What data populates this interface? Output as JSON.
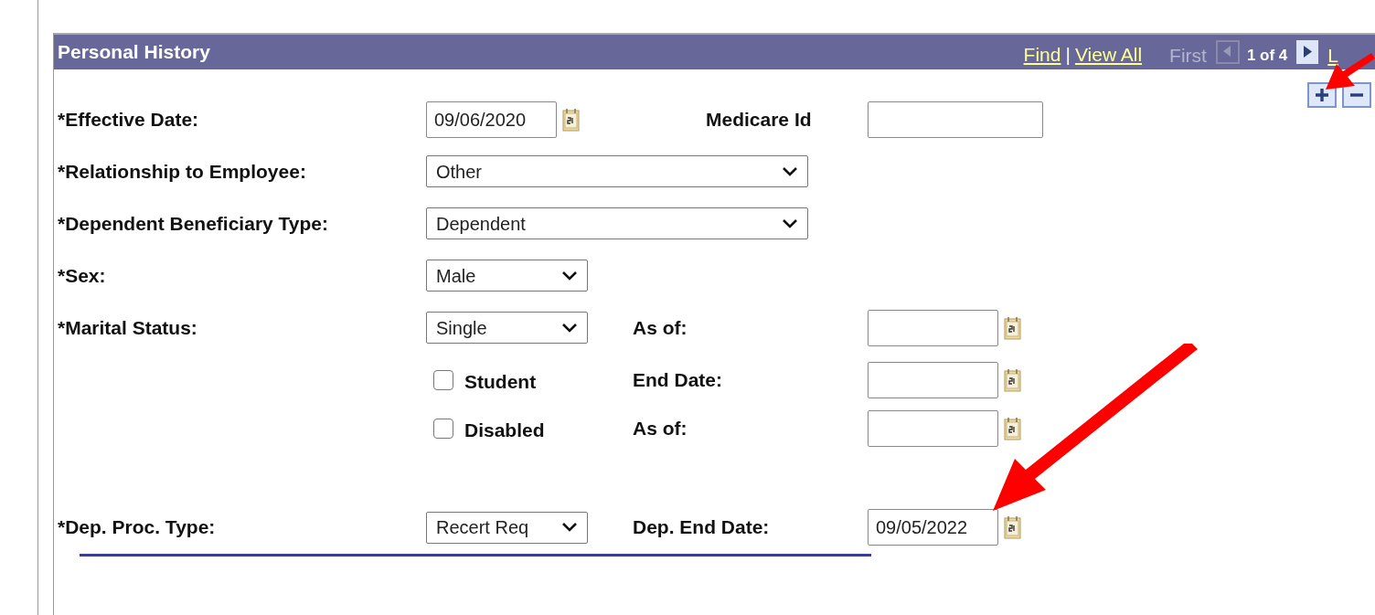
{
  "header": {
    "title": "Personal History",
    "links": [
      "Find",
      "View All"
    ],
    "separator": "|",
    "first": "First",
    "count": "1 of 4",
    "last": "L"
  },
  "rows": [
    {
      "label": "*Effective Date:",
      "control": {
        "kind": "date",
        "value": "09/06/2020"
      },
      "side": {
        "label": "Medicare Id",
        "control": {
          "kind": "text"
        }
      }
    },
    {
      "label": "*Relationship to Employee:",
      "control": {
        "kind": "select",
        "value": "Other",
        "wide": true
      }
    },
    {
      "label": "*Dependent Beneficiary Type:",
      "control": {
        "kind": "select",
        "value": "Dependent",
        "wide": true
      }
    },
    {
      "label": "*Sex:",
      "control": {
        "kind": "select",
        "value": "Male",
        "wide": false
      }
    },
    {
      "label": "*Marital Status:",
      "control": {
        "kind": "select",
        "value": "Single",
        "wide": false
      },
      "side": {
        "label": "As of:",
        "control": {
          "kind": "date"
        }
      }
    },
    {
      "control": {
        "kind": "checkbox",
        "label": "Student",
        "checked": false
      },
      "side": {
        "label": "End Date:",
        "control": {
          "kind": "date"
        }
      }
    },
    {
      "control": {
        "kind": "checkbox",
        "label": "Disabled",
        "checked": false
      },
      "side": {
        "label": "As of:",
        "control": {
          "kind": "date"
        }
      }
    },
    {
      "label": "*Dep. Proc. Type:",
      "control": {
        "kind": "select",
        "value": "Recert Req",
        "wide": false
      },
      "side": {
        "label": "Dep. End Date:",
        "control": {
          "kind": "date",
          "value": "09/05/2022"
        }
      }
    }
  ]
}
